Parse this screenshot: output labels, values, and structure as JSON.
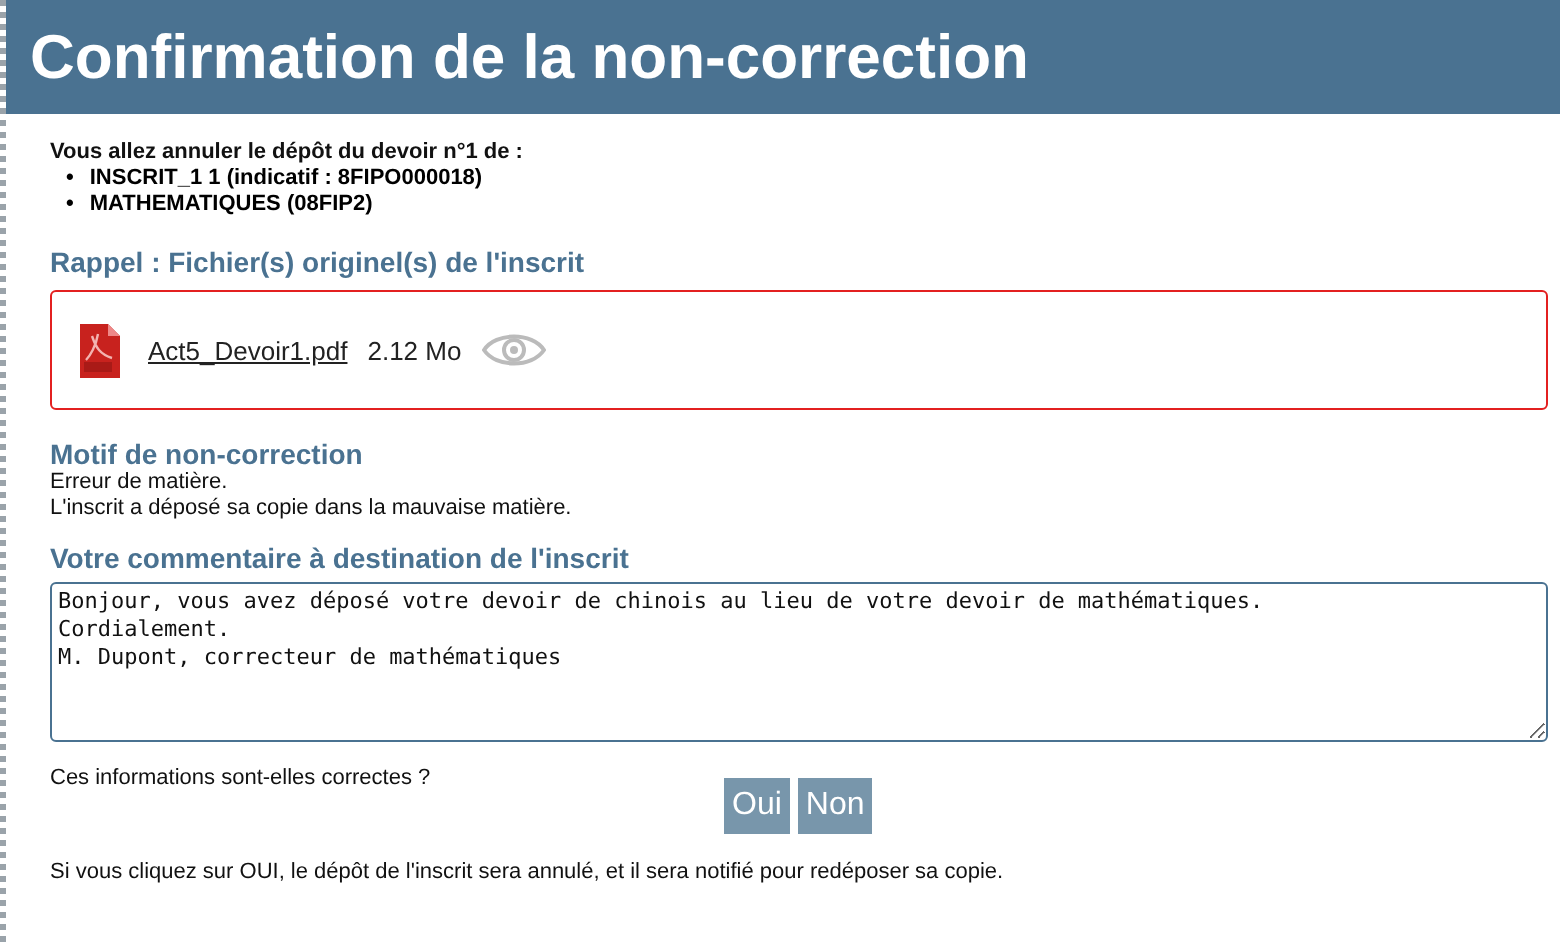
{
  "title": "Confirmation de la non-correction",
  "intro": {
    "text": "Vous allez annuler le dépôt du devoir n°1 de :",
    "items": [
      {
        "bullet": "•",
        "text": "INSCRIT_1 1 (indicatif : 8FIPO000018)"
      },
      {
        "bullet": "•",
        "text": "MATHEMATIQUES (08FIP2)"
      }
    ]
  },
  "files_section": {
    "heading": "Rappel : Fichier(s) originel(s) de l'inscrit",
    "files": [
      {
        "name": "Act5_Devoir1.pdf",
        "size": "2.12 Mo"
      }
    ]
  },
  "reason": {
    "heading": "Motif de non-correction",
    "lines": [
      "Erreur de matière.",
      "L'inscrit a déposé sa copie dans la mauvaise matière."
    ]
  },
  "comment": {
    "heading": "Votre commentaire à destination de l'inscrit",
    "value": "Bonjour, vous avez déposé votre devoir de chinois au lieu de votre devoir de mathématiques.\nCordialement.\nM. Dupont, correcteur de mathématiques"
  },
  "question": "Ces informations sont-elles correctes ?",
  "buttons": [
    "Oui",
    "Non"
  ],
  "note": "Si vous cliquez sur OUI, le dépôt de l'inscrit sera annulé, et il sera notifié pour redéposer sa copie."
}
